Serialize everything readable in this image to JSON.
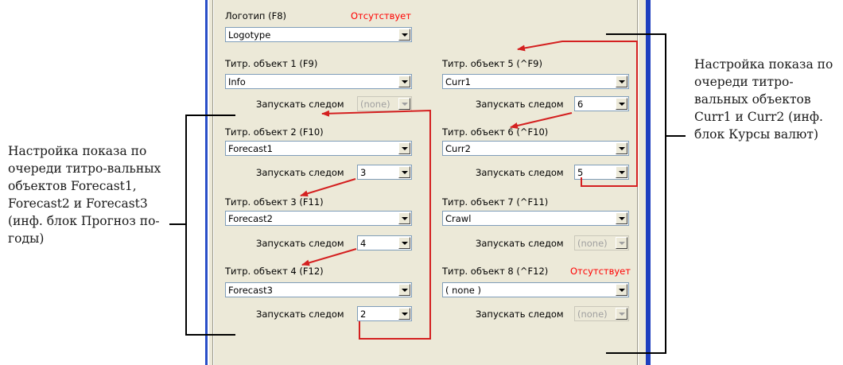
{
  "annotations": {
    "left": "Настройка показа по очереди титро-вальных объектов Forecast1, Forecast2 и Forecast3 (инф. блок Прогноз по-годы)",
    "right": "Настройка показа по очереди титро-вальных объектов Curr1 и Curr2 (инф. блок Курсы валют)"
  },
  "logo": {
    "label": "Логотип (F8)",
    "status": "Отсутствует",
    "value": "Logotype"
  },
  "follow_label": "Запускать следом",
  "left_column": [
    {
      "label": "Титр. объект 1 (F9)",
      "value": "Info",
      "follow": "(none)",
      "follow_disabled": true
    },
    {
      "label": "Титр. объект 2 (F10)",
      "value": "Forecast1",
      "follow": "3",
      "follow_disabled": false
    },
    {
      "label": "Титр. объект 3 (F11)",
      "value": "Forecast2",
      "follow": "4",
      "follow_disabled": false
    },
    {
      "label": "Титр. объект 4 (F12)",
      "value": "Forecast3",
      "follow": "2",
      "follow_disabled": false
    }
  ],
  "right_column": [
    {
      "label": "Титр. объект 5 (^F9)",
      "value": "Curr1",
      "follow": "6",
      "follow_disabled": false
    },
    {
      "label": "Титр. объект 6 (^F10)",
      "value": "Curr2",
      "follow": "5",
      "follow_disabled": false
    },
    {
      "label": "Титр. объект 7 (^F11)",
      "value": "Crawl",
      "follow": "(none)",
      "follow_disabled": true
    },
    {
      "label": "Титр. объект 8 (^F12)",
      "status": "Отсутствует",
      "value": "( none )",
      "follow": "(none)",
      "follow_disabled": true
    }
  ],
  "colors": {
    "dialog_bg": "#ece9d8",
    "accent_border": "#1e3fbf",
    "missing_text": "#ff0000",
    "arrow_red": "#d42020"
  }
}
